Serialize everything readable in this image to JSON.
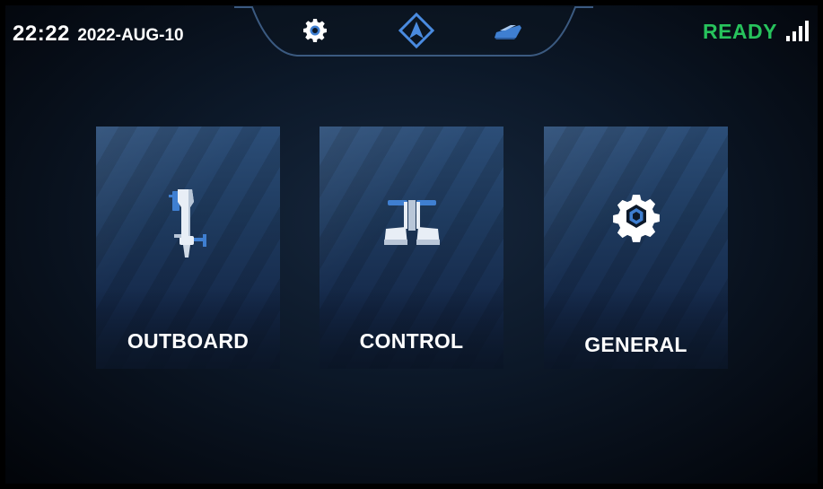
{
  "header": {
    "time": "22:22",
    "date": "2022-AUG-10",
    "status": "READY",
    "nav": [
      {
        "id": "settings",
        "icon": "gear-icon"
      },
      {
        "id": "navigation",
        "icon": "navigation-arrow-icon"
      },
      {
        "id": "boat",
        "icon": "boat-icon"
      }
    ],
    "signal_bars": 4
  },
  "menu": {
    "items": [
      {
        "label": "OUTBOARD",
        "icon": "outboard-motor-icon"
      },
      {
        "label": "CONTROL",
        "icon": "throttle-control-icon"
      },
      {
        "label": "GENERAL",
        "icon": "gear-icon"
      }
    ]
  },
  "colors": {
    "accent": "#3f7fd1",
    "ready": "#27c25c",
    "text": "#ffffff",
    "card": "#1e3a5e"
  }
}
